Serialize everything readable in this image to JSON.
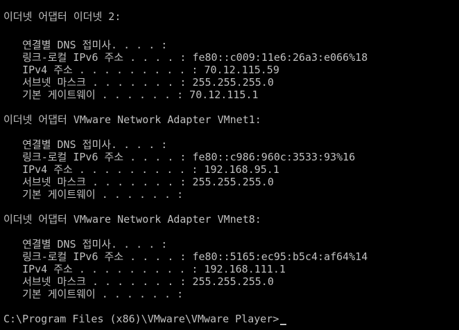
{
  "console": {
    "lines": [
      "이더넷 어댑터 이더넷 2:",
      "",
      "   연결별 DNS 접미사. . . . :",
      "   링크-로컬 IPv6 주소 . . . . : fe80::c009:11e6:26a3:e066%18",
      "   IPv4 주소 . . . . . . . . . : 70.12.115.59",
      "   서브넷 마스크 . . . . . . . : 255.255.255.0",
      "   기본 게이트웨이 . . . . . . : 70.12.115.1",
      "",
      "이더넷 어댑터 VMware Network Adapter VMnet1:",
      "",
      "   연결별 DNS 접미사. . . . :",
      "   링크-로컬 IPv6 주소 . . . . : fe80::c986:960c:3533:93%16",
      "   IPv4 주소 . . . . . . . . . : 192.168.95.1",
      "   서브넷 마스크 . . . . . . . : 255.255.255.0",
      "   기본 게이트웨이 . . . . . . :",
      "",
      "이더넷 어댑터 VMware Network Adapter VMnet8:",
      "",
      "   연결별 DNS 접미사. . . . :",
      "   링크-로컬 IPv6 주소 . . . . : fe80::5165:ec95:b5c4:af64%14",
      "   IPv4 주소 . . . . . . . . . : 192.168.111.1",
      "   서브넷 마스크 . . . . . . . : 255.255.255.0",
      "   기본 게이트웨이 . . . . . . :",
      "",
      "C:\\Program Files (x86)\\VMware\\VMware Player>"
    ]
  },
  "colors": {
    "background": "#000000",
    "text": "#c0c0c0"
  }
}
